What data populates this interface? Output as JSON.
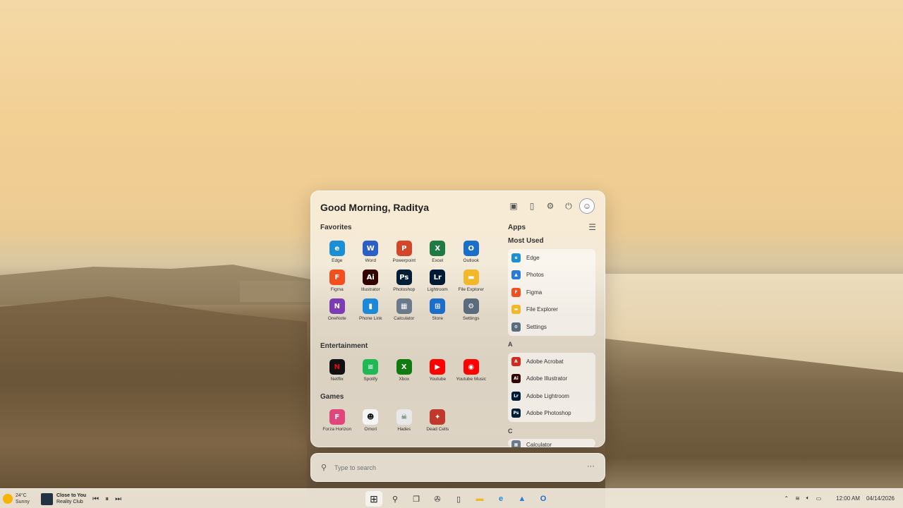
{
  "start_menu": {
    "greeting": "Good Morning, Raditya",
    "favorites_title": "Favorites",
    "favorites": [
      {
        "label": "Edge",
        "icon": "edge-icon",
        "color": "#1a8fd6",
        "glyph": "e"
      },
      {
        "label": "Word",
        "icon": "word-icon",
        "color": "#2b5fc4",
        "glyph": "W"
      },
      {
        "label": "Powerpoint",
        "icon": "powerpoint-icon",
        "color": "#d2462a",
        "glyph": "P"
      },
      {
        "label": "Excel",
        "icon": "excel-icon",
        "color": "#1f7a44",
        "glyph": "X"
      },
      {
        "label": "Outlook",
        "icon": "outlook-icon",
        "color": "#1a6fc9",
        "glyph": "O"
      },
      {
        "label": "Figma",
        "icon": "figma-icon",
        "color": "#f24e1e",
        "glyph": "F"
      },
      {
        "label": "Illustrator",
        "icon": "illustrator-icon",
        "color": "#330000",
        "glyph": "Ai"
      },
      {
        "label": "Photoshop",
        "icon": "photoshop-icon",
        "color": "#001e36",
        "glyph": "Ps"
      },
      {
        "label": "Lightroom",
        "icon": "lightroom-icon",
        "color": "#001a36",
        "glyph": "Lr"
      },
      {
        "label": "File Explorer",
        "icon": "folder-icon",
        "color": "#f2b829",
        "glyph": "▬"
      },
      {
        "label": "OneNote",
        "icon": "onenote-icon",
        "color": "#7b3bb3",
        "glyph": "N"
      },
      {
        "label": "Phone Link",
        "icon": "phone-link-icon",
        "color": "#1e88d8",
        "glyph": "▮"
      },
      {
        "label": "Calculator",
        "icon": "calculator-icon",
        "color": "#6b7a8a",
        "glyph": "▦"
      },
      {
        "label": "Store",
        "icon": "store-icon",
        "color": "#1b6fc8",
        "glyph": "⊞"
      },
      {
        "label": "Settings",
        "icon": "settings-icon",
        "color": "#5a6b7d",
        "glyph": "⚙"
      }
    ],
    "entertainment_title": "Entertainment",
    "entertainment": [
      {
        "label": "Netflix",
        "icon": "netflix-icon",
        "color": "#111111",
        "glyph": "N",
        "fg": "#e50914"
      },
      {
        "label": "Spotify",
        "icon": "spotify-icon",
        "color": "#1db954",
        "glyph": "≋"
      },
      {
        "label": "Xbox",
        "icon": "xbox-icon",
        "color": "#107c10",
        "glyph": "X"
      },
      {
        "label": "Youtube",
        "icon": "youtube-icon",
        "color": "#ff0000",
        "glyph": "▶"
      },
      {
        "label": "Youtube Music",
        "icon": "youtube-music-icon",
        "color": "#ff0000",
        "glyph": "◉"
      }
    ],
    "games_title": "Games",
    "games": [
      {
        "label": "Forza Horizon",
        "icon": "forza-horizon-icon",
        "color": "#e0457b",
        "glyph": "F"
      },
      {
        "label": "Omori",
        "icon": "omori-icon",
        "color": "#f5f5f5",
        "glyph": "☻",
        "fg": "#111"
      },
      {
        "label": "Hades",
        "icon": "hades-icon",
        "color": "#e8e8e8",
        "glyph": "☠",
        "fg": "#1a4a2a"
      },
      {
        "label": "Dead Cells",
        "icon": "dead-cells-icon",
        "color": "#c0392b",
        "glyph": "✦"
      }
    ],
    "apps_title": "Apps",
    "most_used_title": "Most Used",
    "most_used": [
      {
        "label": "Edge",
        "icon": "edge-icon",
        "color": "#1a8fd6",
        "glyph": "e"
      },
      {
        "label": "Photos",
        "icon": "photos-icon",
        "color": "#2a7bd6",
        "glyph": "▲"
      },
      {
        "label": "Figma",
        "icon": "figma-icon",
        "color": "#f24e1e",
        "glyph": "F"
      },
      {
        "label": "File Explorer",
        "icon": "folder-icon",
        "color": "#f2b829",
        "glyph": "▬"
      },
      {
        "label": "Settings",
        "icon": "settings-icon",
        "color": "#5a6b7d",
        "glyph": "⚙"
      }
    ],
    "letter_a": "A",
    "a_apps": [
      {
        "label": "Adobe Acrobat",
        "icon": "acrobat-icon",
        "color": "#d4291f",
        "glyph": "A"
      },
      {
        "label": "Adobe Illustrator",
        "icon": "illustrator-icon",
        "color": "#330000",
        "glyph": "Ai"
      },
      {
        "label": "Adobe Lightroom",
        "icon": "lightroom-icon",
        "color": "#001a36",
        "glyph": "Lr"
      },
      {
        "label": "Adobe Photoshop",
        "icon": "photoshop-icon",
        "color": "#001e36",
        "glyph": "Ps"
      }
    ],
    "letter_c": "C",
    "c_partial": "Calculator"
  },
  "search": {
    "placeholder": "Type to search",
    "more": "···"
  },
  "taskbar": {
    "weather_temp": "24°C",
    "weather_desc": "Sunny",
    "song_title": "Close to You",
    "song_artist": "Reality Club",
    "time": "12:00 AM",
    "date": "04/14/2026"
  }
}
